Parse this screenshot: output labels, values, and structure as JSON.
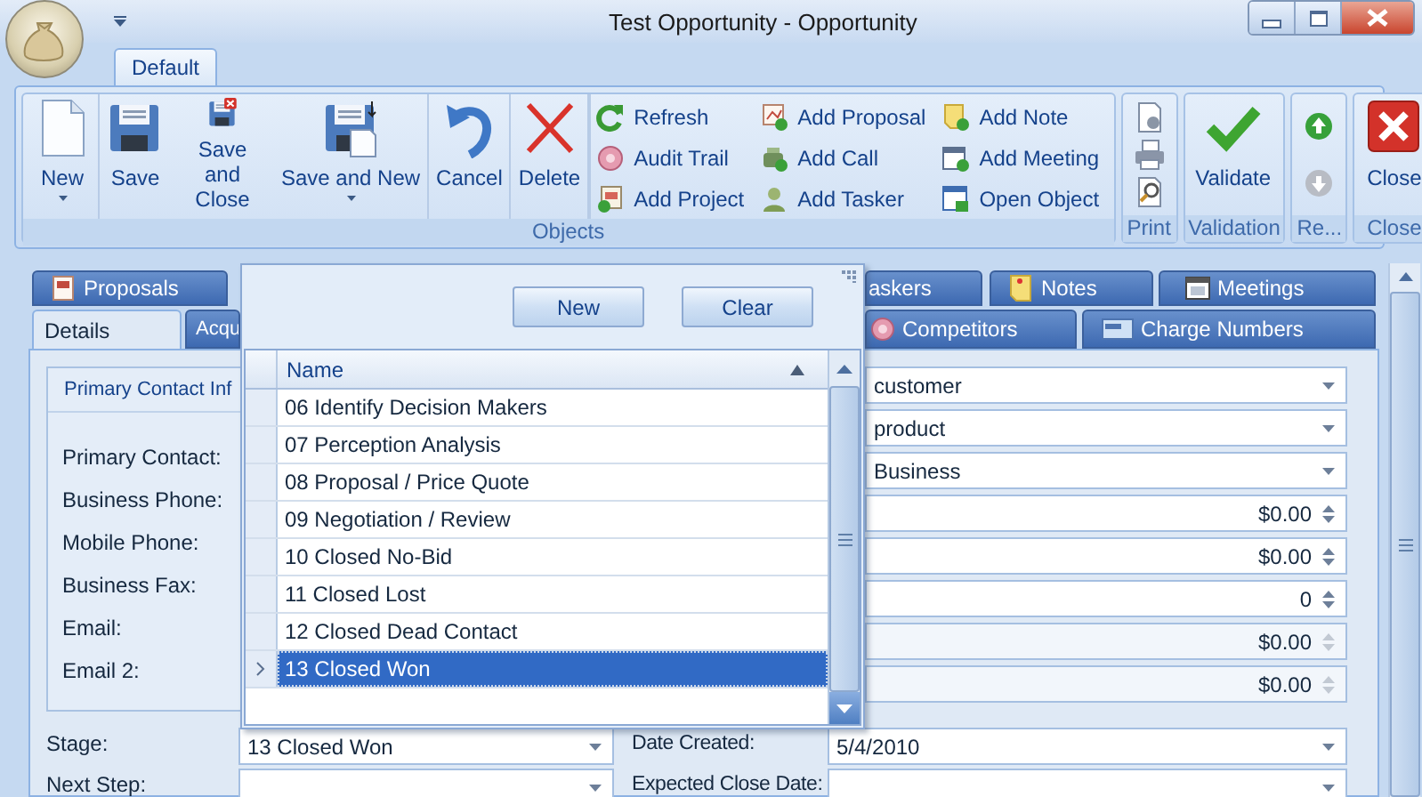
{
  "window": {
    "title": "Test Opportunity - Opportunity"
  },
  "ribbon_tabs": [
    {
      "label": "Default",
      "selected": true
    }
  ],
  "ribbon_groups": [
    {
      "label": "Objects",
      "items": [
        {
          "kind": "large",
          "label": "New",
          "dropdown": true
        },
        {
          "kind": "large",
          "label": "Save",
          "dropdown": false
        },
        {
          "kind": "large",
          "label": "Save and Close",
          "dropdown": false
        },
        {
          "kind": "large",
          "label": "Save and New",
          "dropdown": true
        },
        {
          "kind": "large",
          "label": "Cancel",
          "dropdown": false
        },
        {
          "kind": "large",
          "label": "Delete",
          "dropdown": false
        },
        {
          "kind": "small",
          "label": "Refresh"
        },
        {
          "kind": "small",
          "label": "Audit Trail"
        },
        {
          "kind": "small",
          "label": "Add Project"
        },
        {
          "kind": "small",
          "label": "Add Proposal"
        },
        {
          "kind": "small",
          "label": "Add Call"
        },
        {
          "kind": "small",
          "label": "Add Tasker"
        },
        {
          "kind": "small",
          "label": "Add Note"
        },
        {
          "kind": "small",
          "label": "Add Meeting"
        },
        {
          "kind": "small",
          "label": "Open Object"
        }
      ]
    },
    {
      "label": "Print",
      "items": [
        {
          "kind": "icon"
        },
        {
          "kind": "icon"
        },
        {
          "kind": "icon"
        }
      ]
    },
    {
      "label": "Validation",
      "items": [
        {
          "kind": "large",
          "label": "Validate",
          "dropdown": false
        }
      ]
    },
    {
      "label": "Re...",
      "items": [
        {
          "kind": "icon",
          "disabled": false
        },
        {
          "kind": "icon",
          "disabled": true
        }
      ]
    },
    {
      "label": "Close",
      "items": [
        {
          "kind": "large",
          "label": "Close",
          "dropdown": false
        }
      ]
    }
  ],
  "form_tabs": {
    "row_1": [
      {
        "label": "Proposals",
        "selected": false
      },
      {
        "label": "askers",
        "selected": false
      },
      {
        "label": "Notes",
        "selected": false
      },
      {
        "label": "Meetings",
        "selected": false
      }
    ],
    "row_2": [
      {
        "label": "Details",
        "selected": true
      },
      {
        "label": "Acqu",
        "selected": false
      },
      {
        "label": "Competitors",
        "selected": false
      },
      {
        "label": "Charge Numbers",
        "selected": false
      }
    ]
  },
  "contact_group": {
    "title": "Primary Contact Inf",
    "labels": [
      "Primary Contact:",
      "Business Phone:",
      "Mobile Phone:",
      "Business Fax:",
      "Email:",
      "Email 2:"
    ]
  },
  "right_fields": [
    {
      "kind": "combo",
      "value": "customer",
      "disabled": false
    },
    {
      "kind": "combo",
      "value": "product",
      "disabled": false
    },
    {
      "kind": "combo",
      "value": "Business",
      "disabled": false
    },
    {
      "kind": "spin",
      "value": "$0.00",
      "disabled": false
    },
    {
      "kind": "spin",
      "value": "$0.00",
      "disabled": false
    },
    {
      "kind": "spin",
      "value": "0",
      "disabled": false
    },
    {
      "kind": "spin",
      "value": "$0.00",
      "disabled": true
    },
    {
      "kind": "spin",
      "value": "$0.00",
      "disabled": true
    }
  ],
  "bottom_rows": [
    [
      {
        "label": "Stage:",
        "value": "13 Closed Won"
      },
      {
        "label": "Date Created:",
        "value": "5/4/2010"
      }
    ],
    [
      {
        "label": "Next Step:"
      },
      {
        "label": "Expected Close Date:"
      }
    ]
  ],
  "stage_popup": {
    "buttons": [
      "New",
      "Clear"
    ],
    "column": "Name",
    "rows": [
      {
        "name": "06 Identify Decision Makers",
        "selected": false
      },
      {
        "name": "07 Perception Analysis",
        "selected": false
      },
      {
        "name": "08 Proposal / Price Quote",
        "selected": false
      },
      {
        "name": "09 Negotiation / Review",
        "selected": false
      },
      {
        "name": "10 Closed No-Bid",
        "selected": false
      },
      {
        "name": "11 Closed Lost",
        "selected": false
      },
      {
        "name": "12 Closed Dead Contact",
        "selected": false
      },
      {
        "name": "13 Closed Won",
        "selected": true
      }
    ]
  }
}
